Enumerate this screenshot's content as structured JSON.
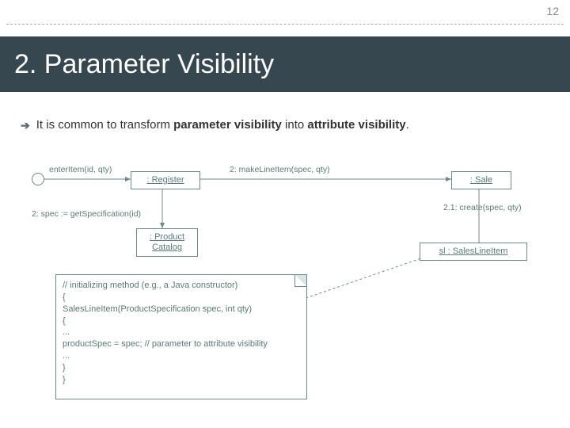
{
  "page": {
    "number": "12"
  },
  "title": "2. Parameter Visibility",
  "bullet": {
    "prefix_text": "It is common to transform ",
    "bold1": "parameter visibility",
    "mid_text": " into ",
    "bold2": "attribute visibility",
    "suffix_text": "."
  },
  "diagram": {
    "msg_enter": "enterItem(id, qty)",
    "msg_spec": "2: spec := getSpecification(id)",
    "msg_make": "2: makeLineItem(spec, qty)",
    "msg_create": "2.1: create(spec, qty)",
    "obj_register": ": Register",
    "obj_sale": ": Sale",
    "obj_catalog_line1": ": Product",
    "obj_catalog_line2": "Catalog",
    "obj_sli": "sl : SalesLineItem",
    "note": {
      "line1": "// initializing method (e.g., a Java constructor)",
      "line2": "{",
      "line3": "SalesLineItem(ProductSpecification spec, int qty)",
      "line4": "{",
      "line5": "...",
      "line6": "productSpec = spec;  // parameter to attribute visibility",
      "line7": "...",
      "line8": "}",
      "line9": "}"
    }
  }
}
